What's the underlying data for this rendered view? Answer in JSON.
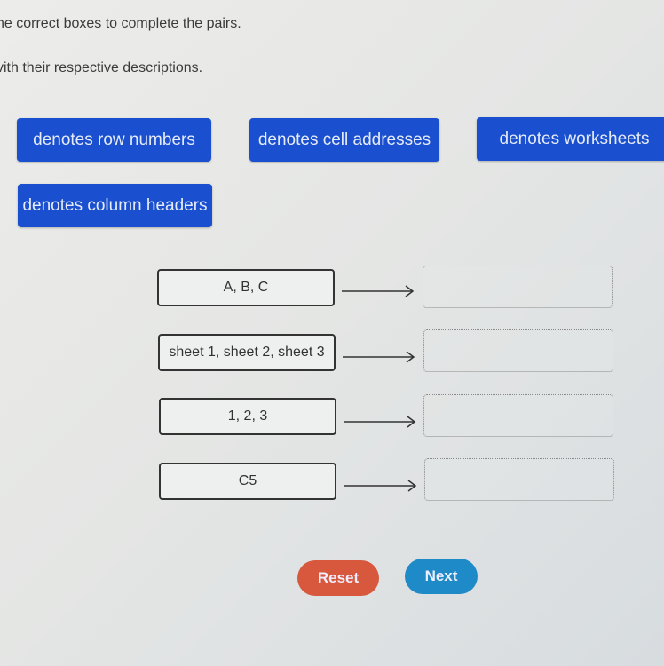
{
  "instructions": {
    "line1": "ne correct boxes to complete the pairs.",
    "line2": "vith their respective descriptions."
  },
  "tiles": [
    {
      "label": "denotes row numbers"
    },
    {
      "label": "denotes cell addresses"
    },
    {
      "label": "denotes worksheets"
    },
    {
      "label": "denotes column headers"
    }
  ],
  "pairs": [
    {
      "term": "A, B, C",
      "target": ""
    },
    {
      "term": "sheet 1, sheet 2, sheet 3",
      "target": ""
    },
    {
      "term": "1, 2, 3",
      "target": ""
    },
    {
      "term": "C5",
      "target": ""
    }
  ],
  "buttons": {
    "reset": "Reset",
    "next": "Next"
  },
  "colors": {
    "tile": "#1a4fcf",
    "reset": "#d8583d",
    "next": "#1f8ac8"
  }
}
